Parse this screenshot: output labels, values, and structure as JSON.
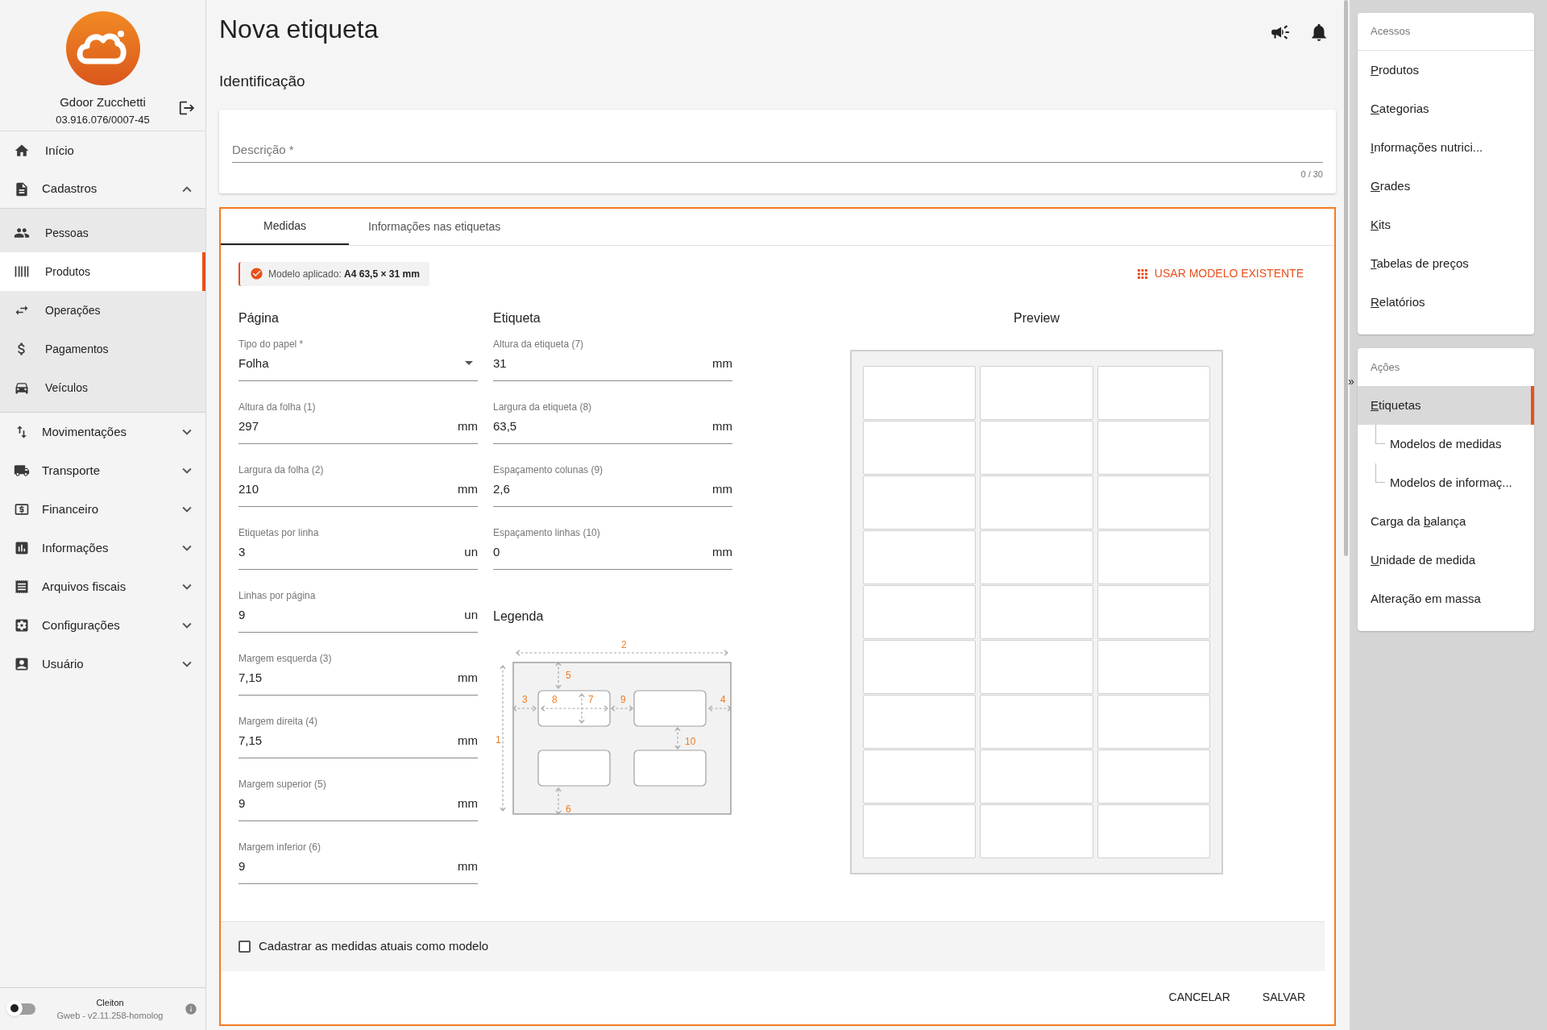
{
  "sidebar": {
    "company": {
      "name": "Gdoor Zucchetti",
      "cnpj": "03.916.076/0007-45"
    },
    "items": [
      {
        "kind": "link",
        "label": "Início"
      },
      {
        "kind": "group",
        "label": "Cadastros",
        "expanded": true,
        "children": [
          {
            "label": "Pessoas",
            "selected": false
          },
          {
            "label": "Produtos",
            "selected": true
          },
          {
            "label": "Operações",
            "selected": false
          },
          {
            "label": "Pagamentos",
            "selected": false
          },
          {
            "label": "Veículos",
            "selected": false
          }
        ]
      },
      {
        "kind": "group",
        "label": "Movimentações",
        "expanded": false
      },
      {
        "kind": "group",
        "label": "Transporte",
        "expanded": false
      },
      {
        "kind": "group",
        "label": "Financeiro",
        "expanded": false
      },
      {
        "kind": "group",
        "label": "Informações",
        "expanded": false
      },
      {
        "kind": "group",
        "label": "Arquivos fiscais",
        "expanded": false
      },
      {
        "kind": "group",
        "label": "Configurações",
        "expanded": false
      },
      {
        "kind": "group",
        "label": "Usuário",
        "expanded": false
      }
    ],
    "footer": {
      "user": "Cleiton",
      "version": "Gweb - v2.11.258-homolog",
      "dark_mode": false
    }
  },
  "page": {
    "title": "Nova etiqueta",
    "section": "Identificação",
    "description": {
      "placeholder": "Descrição *",
      "counter": "0 / 30"
    },
    "tabs": [
      {
        "label": "Medidas",
        "selected": true
      },
      {
        "label": "Informações nas etiquetas",
        "selected": false
      }
    ],
    "applied_model": {
      "label": "Modelo aplicado:",
      "value": "A4 63,5 × 31 mm"
    },
    "use_model_button": "USAR MODELO EXISTENTE",
    "page_section": {
      "title": "Página",
      "fields": [
        {
          "kind": "select",
          "label": "Tipo do papel *",
          "value": "Folha"
        },
        {
          "kind": "input",
          "label": "Altura da folha (1)",
          "value": "297",
          "unit": "mm"
        },
        {
          "kind": "input",
          "label": "Largura da folha (2)",
          "value": "210",
          "unit": "mm"
        },
        {
          "kind": "input",
          "label": "Etiquetas por linha",
          "value": "3",
          "unit": "un"
        },
        {
          "kind": "input",
          "label": "Linhas por página",
          "value": "9",
          "unit": "un"
        },
        {
          "kind": "input",
          "label": "Margem esquerda (3)",
          "value": "7,15",
          "unit": "mm"
        },
        {
          "kind": "input",
          "label": "Margem direita (4)",
          "value": "7,15",
          "unit": "mm"
        },
        {
          "kind": "input",
          "label": "Margem superior (5)",
          "value": "9",
          "unit": "mm"
        },
        {
          "kind": "input",
          "label": "Margem inferior (6)",
          "value": "9",
          "unit": "mm"
        }
      ]
    },
    "label_section": {
      "title": "Etiqueta",
      "fields": [
        {
          "kind": "input",
          "label": "Altura da etiqueta (7)",
          "value": "31",
          "unit": "mm"
        },
        {
          "kind": "input",
          "label": "Largura da etiqueta (8)",
          "value": "63,5",
          "unit": "mm"
        },
        {
          "kind": "input",
          "label": "Espaçamento colunas (9)",
          "value": "2,6",
          "unit": "mm"
        },
        {
          "kind": "input",
          "label": "Espaçamento linhas (10)",
          "value": "0",
          "unit": "mm"
        }
      ]
    },
    "legend": {
      "title": "Legenda",
      "numbers": [
        "2",
        "5",
        "3",
        "8",
        "7",
        "9",
        "4",
        "1",
        "10",
        "6"
      ]
    },
    "preview": {
      "title": "Preview"
    },
    "save_as_model": {
      "label": "Cadastrar as medidas atuais como modelo",
      "checked": false
    },
    "buttons": [
      "CANCELAR",
      "SALVAR"
    ]
  },
  "right_panel": {
    "expand_toggle": "»",
    "sections": [
      {
        "title": "Acessos",
        "items": [
          {
            "key": "P",
            "post": "rodutos"
          },
          {
            "key": "C",
            "post": "ategorias"
          },
          {
            "key": "I",
            "post": "nformações nutrici..."
          },
          {
            "key": "G",
            "post": "rades"
          },
          {
            "key": "K",
            "post": "its"
          },
          {
            "key": "T",
            "post": "abelas de preços"
          },
          {
            "key": "R",
            "post": "elatórios"
          }
        ]
      },
      {
        "title": "Ações",
        "items": [
          {
            "key": "E",
            "post": "tiquetas",
            "selected": true,
            "children": [
              {
                "label": "Modelos de medidas"
              },
              {
                "label": "Modelos de informaç..."
              }
            ]
          },
          {
            "pre": "Carga da ",
            "key": "b",
            "post": "alança",
            "selected": false
          },
          {
            "key": "U",
            "post": "nidade de medida",
            "selected": false
          },
          {
            "label": "Alteração em massa",
            "selected": false
          }
        ]
      }
    ]
  }
}
